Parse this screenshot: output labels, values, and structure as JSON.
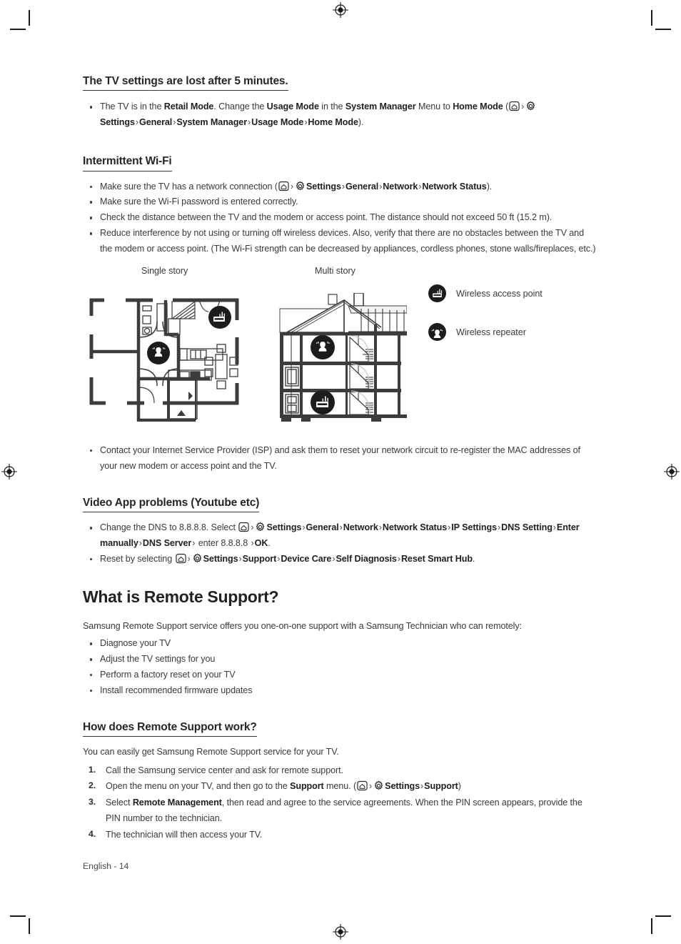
{
  "page": {
    "footer": "English - 14"
  },
  "section_tv_settings": {
    "heading": "The TV settings are lost after 5 minutes.",
    "bullet": {
      "t1": "The TV is in the ",
      "b1": "Retail Mode",
      "t2": ". Change the ",
      "b2": "Usage Mode",
      "t3": " in the ",
      "b3": "System Manager",
      "t4": " Menu to ",
      "b4": "Home Mode",
      "t5": " (",
      "path": [
        "Settings",
        "General",
        "System Manager",
        "Usage Mode",
        "Home Mode"
      ],
      "t6": ")."
    }
  },
  "section_wifi": {
    "heading": "Intermittent Wi-Fi",
    "bullet1": {
      "t1": "Make sure the TV has a network connection (",
      "path": [
        "Settings",
        "General",
        "Network",
        "Network Status"
      ],
      "t2": ")."
    },
    "bullet2": "Make sure the Wi-Fi password is entered correctly.",
    "bullet3": "Check the distance between the TV and the modem or access point. The distance should not exceed 50 ft (15.2 m).",
    "bullet4": "Reduce interference by not using or turning off wireless devices. Also, verify that there are no obstacles between the TV and the modem or access point. (The Wi-Fi strength can be decreased by appliances, cordless phones, stone walls/fireplaces, etc.)",
    "bullet5": "Contact your Internet Service Provider (ISP) and ask them to reset your network circuit to re-register the MAC addresses of your new modem or access point and the TV.",
    "diagram": {
      "label_single": "Single story",
      "label_multi": "Multi story",
      "legend": [
        {
          "icon": "wireless-access-point-icon",
          "label": "Wireless access point"
        },
        {
          "icon": "wireless-repeater-icon",
          "label": "Wireless repeater"
        }
      ]
    }
  },
  "section_video_app": {
    "heading": "Video App problems (Youtube etc)",
    "bullet1": {
      "t1": "Change the DNS to 8.8.8.8. Select ",
      "path": [
        "Settings",
        "General",
        "Network",
        "Network Status",
        "IP Settings",
        "DNS Setting",
        "Enter manually",
        "DNS Server"
      ],
      "t2": " enter 8.8.8.8 ",
      "b_last": "OK",
      "t3": "."
    },
    "bullet2": {
      "t1": "Reset by selecting ",
      "path": [
        "Settings",
        "Support",
        "Device Care",
        "Self Diagnosis",
        "Reset Smart Hub"
      ],
      "t2": "."
    }
  },
  "section_remote_support": {
    "heading": "What is Remote Support?",
    "intro": "Samsung Remote Support service offers you one-on-one support with a Samsung Technician who can remotely:",
    "bullets": [
      "Diagnose your TV",
      "Adjust the TV settings for you",
      "Perform a factory reset on your TV",
      "Install recommended firmware updates"
    ]
  },
  "section_how_works": {
    "heading": "How does Remote Support work?",
    "intro": "You can easily get Samsung Remote Support service for your TV.",
    "steps": [
      {
        "n": "1.",
        "t1": "Call the Samsung service center and ask for remote support."
      },
      {
        "n": "2.",
        "t1": "Open the menu on your TV, and then go to the ",
        "b1": "Support",
        "t2": " menu. (",
        "path": [
          "Settings",
          "Support"
        ],
        "t3": ")"
      },
      {
        "n": "3.",
        "t1": "Select ",
        "b1": "Remote Management",
        "t2": ", then read and agree to the service agreements. When the PIN screen appears, provide the PIN number to the technician."
      },
      {
        "n": "4.",
        "t1": "The technician will then access your TV."
      }
    ]
  },
  "icons": {
    "home": "home-icon",
    "gear": "settings-gear-icon",
    "chevron": "›"
  },
  "colors": {
    "text": "#3a3a3a",
    "heading": "#222222",
    "rule": "#3a3a3a",
    "badge": "#1c1c1c"
  }
}
